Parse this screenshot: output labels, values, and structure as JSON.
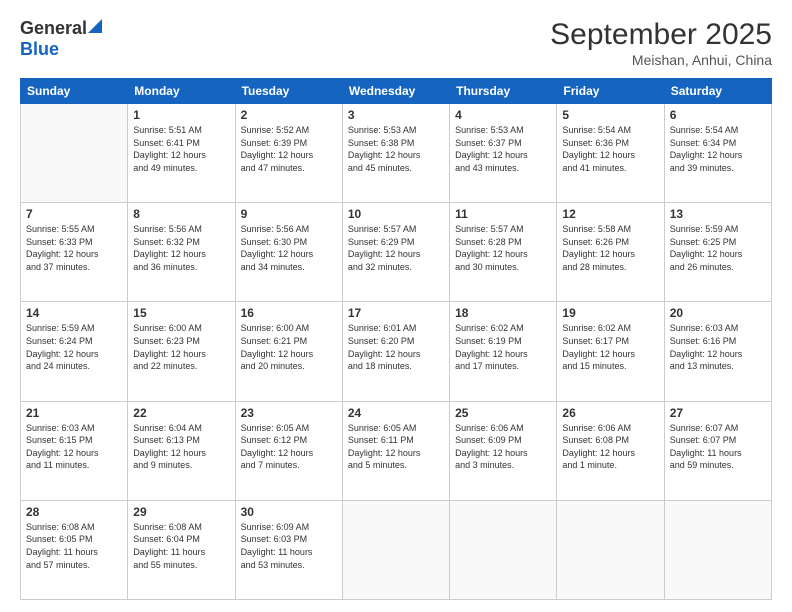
{
  "logo": {
    "general": "General",
    "blue": "Blue"
  },
  "header": {
    "month": "September 2025",
    "location": "Meishan, Anhui, China"
  },
  "weekdays": [
    "Sunday",
    "Monday",
    "Tuesday",
    "Wednesday",
    "Thursday",
    "Friday",
    "Saturday"
  ],
  "weeks": [
    [
      {
        "day": "",
        "info": ""
      },
      {
        "day": "1",
        "info": "Sunrise: 5:51 AM\nSunset: 6:41 PM\nDaylight: 12 hours\nand 49 minutes."
      },
      {
        "day": "2",
        "info": "Sunrise: 5:52 AM\nSunset: 6:39 PM\nDaylight: 12 hours\nand 47 minutes."
      },
      {
        "day": "3",
        "info": "Sunrise: 5:53 AM\nSunset: 6:38 PM\nDaylight: 12 hours\nand 45 minutes."
      },
      {
        "day": "4",
        "info": "Sunrise: 5:53 AM\nSunset: 6:37 PM\nDaylight: 12 hours\nand 43 minutes."
      },
      {
        "day": "5",
        "info": "Sunrise: 5:54 AM\nSunset: 6:36 PM\nDaylight: 12 hours\nand 41 minutes."
      },
      {
        "day": "6",
        "info": "Sunrise: 5:54 AM\nSunset: 6:34 PM\nDaylight: 12 hours\nand 39 minutes."
      }
    ],
    [
      {
        "day": "7",
        "info": "Sunrise: 5:55 AM\nSunset: 6:33 PM\nDaylight: 12 hours\nand 37 minutes."
      },
      {
        "day": "8",
        "info": "Sunrise: 5:56 AM\nSunset: 6:32 PM\nDaylight: 12 hours\nand 36 minutes."
      },
      {
        "day": "9",
        "info": "Sunrise: 5:56 AM\nSunset: 6:30 PM\nDaylight: 12 hours\nand 34 minutes."
      },
      {
        "day": "10",
        "info": "Sunrise: 5:57 AM\nSunset: 6:29 PM\nDaylight: 12 hours\nand 32 minutes."
      },
      {
        "day": "11",
        "info": "Sunrise: 5:57 AM\nSunset: 6:28 PM\nDaylight: 12 hours\nand 30 minutes."
      },
      {
        "day": "12",
        "info": "Sunrise: 5:58 AM\nSunset: 6:26 PM\nDaylight: 12 hours\nand 28 minutes."
      },
      {
        "day": "13",
        "info": "Sunrise: 5:59 AM\nSunset: 6:25 PM\nDaylight: 12 hours\nand 26 minutes."
      }
    ],
    [
      {
        "day": "14",
        "info": "Sunrise: 5:59 AM\nSunset: 6:24 PM\nDaylight: 12 hours\nand 24 minutes."
      },
      {
        "day": "15",
        "info": "Sunrise: 6:00 AM\nSunset: 6:23 PM\nDaylight: 12 hours\nand 22 minutes."
      },
      {
        "day": "16",
        "info": "Sunrise: 6:00 AM\nSunset: 6:21 PM\nDaylight: 12 hours\nand 20 minutes."
      },
      {
        "day": "17",
        "info": "Sunrise: 6:01 AM\nSunset: 6:20 PM\nDaylight: 12 hours\nand 18 minutes."
      },
      {
        "day": "18",
        "info": "Sunrise: 6:02 AM\nSunset: 6:19 PM\nDaylight: 12 hours\nand 17 minutes."
      },
      {
        "day": "19",
        "info": "Sunrise: 6:02 AM\nSunset: 6:17 PM\nDaylight: 12 hours\nand 15 minutes."
      },
      {
        "day": "20",
        "info": "Sunrise: 6:03 AM\nSunset: 6:16 PM\nDaylight: 12 hours\nand 13 minutes."
      }
    ],
    [
      {
        "day": "21",
        "info": "Sunrise: 6:03 AM\nSunset: 6:15 PM\nDaylight: 12 hours\nand 11 minutes."
      },
      {
        "day": "22",
        "info": "Sunrise: 6:04 AM\nSunset: 6:13 PM\nDaylight: 12 hours\nand 9 minutes."
      },
      {
        "day": "23",
        "info": "Sunrise: 6:05 AM\nSunset: 6:12 PM\nDaylight: 12 hours\nand 7 minutes."
      },
      {
        "day": "24",
        "info": "Sunrise: 6:05 AM\nSunset: 6:11 PM\nDaylight: 12 hours\nand 5 minutes."
      },
      {
        "day": "25",
        "info": "Sunrise: 6:06 AM\nSunset: 6:09 PM\nDaylight: 12 hours\nand 3 minutes."
      },
      {
        "day": "26",
        "info": "Sunrise: 6:06 AM\nSunset: 6:08 PM\nDaylight: 12 hours\nand 1 minute."
      },
      {
        "day": "27",
        "info": "Sunrise: 6:07 AM\nSunset: 6:07 PM\nDaylight: 11 hours\nand 59 minutes."
      }
    ],
    [
      {
        "day": "28",
        "info": "Sunrise: 6:08 AM\nSunset: 6:05 PM\nDaylight: 11 hours\nand 57 minutes."
      },
      {
        "day": "29",
        "info": "Sunrise: 6:08 AM\nSunset: 6:04 PM\nDaylight: 11 hours\nand 55 minutes."
      },
      {
        "day": "30",
        "info": "Sunrise: 6:09 AM\nSunset: 6:03 PM\nDaylight: 11 hours\nand 53 minutes."
      },
      {
        "day": "",
        "info": ""
      },
      {
        "day": "",
        "info": ""
      },
      {
        "day": "",
        "info": ""
      },
      {
        "day": "",
        "info": ""
      }
    ]
  ]
}
